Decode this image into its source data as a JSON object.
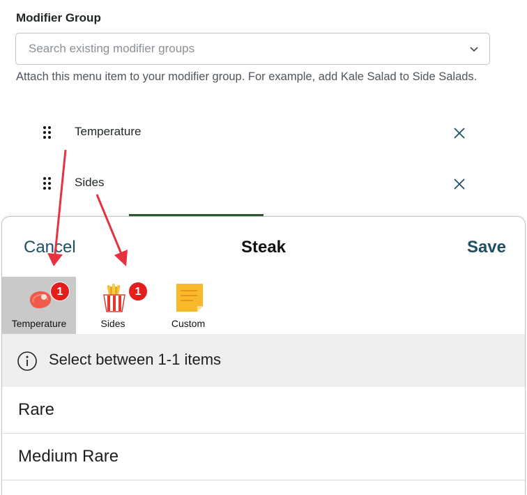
{
  "modifier_group": {
    "title": "Modifier Group",
    "search_placeholder": "Search existing modifier groups",
    "help_text": "Attach this menu item to your modifier group. For example, add Kale Salad to Side Salads.",
    "groups": [
      {
        "name": "Temperature"
      },
      {
        "name": "Sides"
      }
    ]
  },
  "sheet": {
    "cancel_label": "Cancel",
    "title": "Steak",
    "save_label": "Save",
    "tabs": [
      {
        "label": "Temperature",
        "badge": "1",
        "icon": "steak-icon"
      },
      {
        "label": "Sides",
        "badge": "1",
        "icon": "fries-icon"
      },
      {
        "label": "Custom",
        "icon": "sticky-note-icon"
      }
    ],
    "info_text": "Select between 1-1 items",
    "options": [
      {
        "label": "Rare"
      },
      {
        "label": "Medium Rare"
      }
    ]
  },
  "colors": {
    "accent": "#1f4f63",
    "badge": "#e51d1d",
    "annotation_arrow": "#e8313f"
  }
}
